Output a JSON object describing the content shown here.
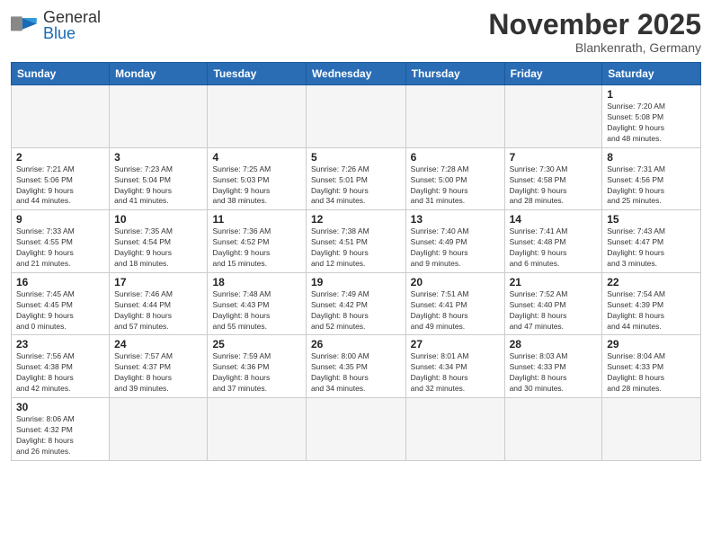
{
  "logo": {
    "text_general": "General",
    "text_blue": "Blue"
  },
  "header": {
    "title": "November 2025",
    "subtitle": "Blankenrath, Germany"
  },
  "weekdays": [
    "Sunday",
    "Monday",
    "Tuesday",
    "Wednesday",
    "Thursday",
    "Friday",
    "Saturday"
  ],
  "weeks": [
    [
      {
        "day": "",
        "info": "",
        "empty": true
      },
      {
        "day": "",
        "info": "",
        "empty": true
      },
      {
        "day": "",
        "info": "",
        "empty": true
      },
      {
        "day": "",
        "info": "",
        "empty": true
      },
      {
        "day": "",
        "info": "",
        "empty": true
      },
      {
        "day": "",
        "info": "",
        "empty": true
      },
      {
        "day": "1",
        "info": "Sunrise: 7:20 AM\nSunset: 5:08 PM\nDaylight: 9 hours\nand 48 minutes."
      }
    ],
    [
      {
        "day": "2",
        "info": "Sunrise: 7:21 AM\nSunset: 5:06 PM\nDaylight: 9 hours\nand 44 minutes."
      },
      {
        "day": "3",
        "info": "Sunrise: 7:23 AM\nSunset: 5:04 PM\nDaylight: 9 hours\nand 41 minutes."
      },
      {
        "day": "4",
        "info": "Sunrise: 7:25 AM\nSunset: 5:03 PM\nDaylight: 9 hours\nand 38 minutes."
      },
      {
        "day": "5",
        "info": "Sunrise: 7:26 AM\nSunset: 5:01 PM\nDaylight: 9 hours\nand 34 minutes."
      },
      {
        "day": "6",
        "info": "Sunrise: 7:28 AM\nSunset: 5:00 PM\nDaylight: 9 hours\nand 31 minutes."
      },
      {
        "day": "7",
        "info": "Sunrise: 7:30 AM\nSunset: 4:58 PM\nDaylight: 9 hours\nand 28 minutes."
      },
      {
        "day": "8",
        "info": "Sunrise: 7:31 AM\nSunset: 4:56 PM\nDaylight: 9 hours\nand 25 minutes."
      }
    ],
    [
      {
        "day": "9",
        "info": "Sunrise: 7:33 AM\nSunset: 4:55 PM\nDaylight: 9 hours\nand 21 minutes."
      },
      {
        "day": "10",
        "info": "Sunrise: 7:35 AM\nSunset: 4:54 PM\nDaylight: 9 hours\nand 18 minutes."
      },
      {
        "day": "11",
        "info": "Sunrise: 7:36 AM\nSunset: 4:52 PM\nDaylight: 9 hours\nand 15 minutes."
      },
      {
        "day": "12",
        "info": "Sunrise: 7:38 AM\nSunset: 4:51 PM\nDaylight: 9 hours\nand 12 minutes."
      },
      {
        "day": "13",
        "info": "Sunrise: 7:40 AM\nSunset: 4:49 PM\nDaylight: 9 hours\nand 9 minutes."
      },
      {
        "day": "14",
        "info": "Sunrise: 7:41 AM\nSunset: 4:48 PM\nDaylight: 9 hours\nand 6 minutes."
      },
      {
        "day": "15",
        "info": "Sunrise: 7:43 AM\nSunset: 4:47 PM\nDaylight: 9 hours\nand 3 minutes."
      }
    ],
    [
      {
        "day": "16",
        "info": "Sunrise: 7:45 AM\nSunset: 4:45 PM\nDaylight: 9 hours\nand 0 minutes."
      },
      {
        "day": "17",
        "info": "Sunrise: 7:46 AM\nSunset: 4:44 PM\nDaylight: 8 hours\nand 57 minutes."
      },
      {
        "day": "18",
        "info": "Sunrise: 7:48 AM\nSunset: 4:43 PM\nDaylight: 8 hours\nand 55 minutes."
      },
      {
        "day": "19",
        "info": "Sunrise: 7:49 AM\nSunset: 4:42 PM\nDaylight: 8 hours\nand 52 minutes."
      },
      {
        "day": "20",
        "info": "Sunrise: 7:51 AM\nSunset: 4:41 PM\nDaylight: 8 hours\nand 49 minutes."
      },
      {
        "day": "21",
        "info": "Sunrise: 7:52 AM\nSunset: 4:40 PM\nDaylight: 8 hours\nand 47 minutes."
      },
      {
        "day": "22",
        "info": "Sunrise: 7:54 AM\nSunset: 4:39 PM\nDaylight: 8 hours\nand 44 minutes."
      }
    ],
    [
      {
        "day": "23",
        "info": "Sunrise: 7:56 AM\nSunset: 4:38 PM\nDaylight: 8 hours\nand 42 minutes."
      },
      {
        "day": "24",
        "info": "Sunrise: 7:57 AM\nSunset: 4:37 PM\nDaylight: 8 hours\nand 39 minutes."
      },
      {
        "day": "25",
        "info": "Sunrise: 7:59 AM\nSunset: 4:36 PM\nDaylight: 8 hours\nand 37 minutes."
      },
      {
        "day": "26",
        "info": "Sunrise: 8:00 AM\nSunset: 4:35 PM\nDaylight: 8 hours\nand 34 minutes."
      },
      {
        "day": "27",
        "info": "Sunrise: 8:01 AM\nSunset: 4:34 PM\nDaylight: 8 hours\nand 32 minutes."
      },
      {
        "day": "28",
        "info": "Sunrise: 8:03 AM\nSunset: 4:33 PM\nDaylight: 8 hours\nand 30 minutes."
      },
      {
        "day": "29",
        "info": "Sunrise: 8:04 AM\nSunset: 4:33 PM\nDaylight: 8 hours\nand 28 minutes."
      }
    ],
    [
      {
        "day": "30",
        "info": "Sunrise: 8:06 AM\nSunset: 4:32 PM\nDaylight: 8 hours\nand 26 minutes."
      },
      {
        "day": "",
        "info": "",
        "empty": true
      },
      {
        "day": "",
        "info": "",
        "empty": true
      },
      {
        "day": "",
        "info": "",
        "empty": true
      },
      {
        "day": "",
        "info": "",
        "empty": true
      },
      {
        "day": "",
        "info": "",
        "empty": true
      },
      {
        "day": "",
        "info": "",
        "empty": true
      }
    ]
  ]
}
